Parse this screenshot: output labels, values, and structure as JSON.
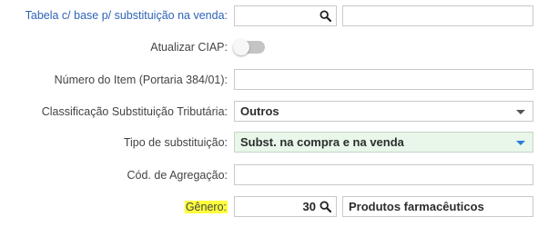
{
  "rows": {
    "tabela": {
      "label": "Tabela c/ base p/ substituição na venda:",
      "value": "",
      "description": ""
    },
    "ciap": {
      "label": "Atualizar CIAP:",
      "enabled": false
    },
    "numero_item": {
      "label": "Número do Item (Portaria 384/01):",
      "value": ""
    },
    "classificacao": {
      "label": "Classificação Substituição Tributária:",
      "selected": "Outros"
    },
    "tipo_substituicao": {
      "label": "Tipo de substituição:",
      "selected": "Subst. na compra e na venda"
    },
    "agregacao": {
      "label": "Cód. de Agregação:",
      "value": ""
    },
    "genero": {
      "label": "Gênero:",
      "code": "30",
      "description": "Produtos farmacêuticos"
    }
  },
  "icons": {
    "search": "search-icon",
    "dropdown": "chevron-down-icon"
  },
  "colors": {
    "link_label": "#2f63b8",
    "highlight": "#ffff3c",
    "selected_bg": "#e8f7ea",
    "caret_active": "#2a7fd4"
  }
}
